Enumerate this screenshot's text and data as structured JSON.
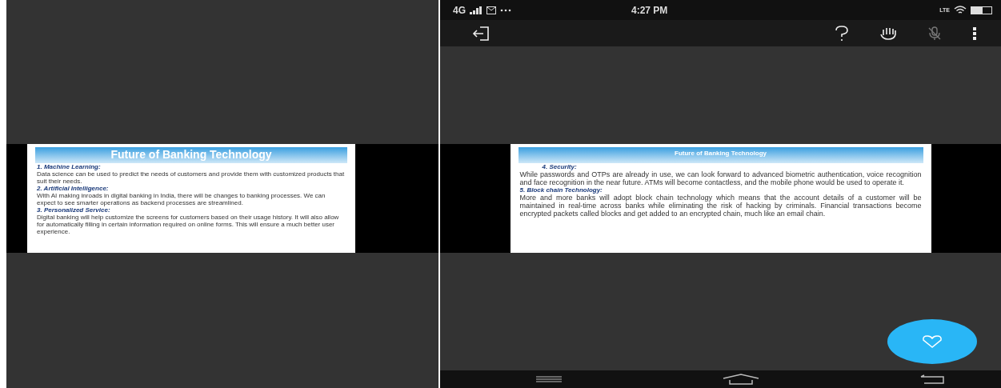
{
  "left_slide": {
    "title": "Future of Banking Technology",
    "sections": [
      {
        "heading": "1. Machine Learning:",
        "body": "Data science can be used to predict the needs of customers and provide them with customized products that suit their needs."
      },
      {
        "heading": "2. Artificial Intelligence:",
        "body": "With AI making inroads in digital banking in India, there will be changes to banking processes. We can expect to see smarter operations as backend processes are streamlined."
      },
      {
        "heading": "3. Personalized Service:",
        "body": "Digital banking will help customize the screens for customers based on their usage history. It will also allow for automatically filling in certain information required on online forms. This will ensure a much better user experience."
      }
    ]
  },
  "status_bar": {
    "network": "4G",
    "time": "4:27 PM",
    "lte": "LTE"
  },
  "right_slide": {
    "title": "Future of Banking Technology",
    "sections": [
      {
        "heading": "4. Security:",
        "body": "While passwords and OTPs are already in use, we can look forward to advanced biometric authentication, voice recognition and face recognition in the near future. ATMs will become contactless, and the mobile phone would be used to operate it."
      },
      {
        "heading": "5. Block chain Technology:",
        "body": "More and more banks will adopt block chain technology which means that the account details of a customer will be maintained in real-time across banks while eliminating the risk of hacking by criminals. Financial transactions become encrypted packets called blocks and get added to an encrypted chain, much like an email chain."
      }
    ]
  }
}
